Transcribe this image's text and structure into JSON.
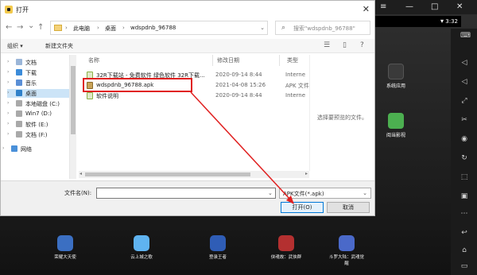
{
  "dialog": {
    "title": "打开",
    "close_glyph": "✕",
    "nav": {
      "back": "←",
      "forward": "→",
      "dropdown": "⌄",
      "up": "↑"
    },
    "breadcrumb": [
      "此电脑",
      "桌面",
      "wdspdnb_96788"
    ],
    "breadcrumb_sep": "›",
    "search_placeholder": "搜索\"wdspdnb_96788\"",
    "toolbar": {
      "organize": "组织 ▾",
      "new_folder": "新建文件夹"
    },
    "nav_pane": [
      {
        "label": "文档",
        "icon": "documents-icon"
      },
      {
        "label": "下载",
        "icon": "download-icon"
      },
      {
        "label": "音乐",
        "icon": "music-icon"
      },
      {
        "label": "桌面",
        "icon": "desktop-icon",
        "selected": true
      },
      {
        "label": "本地磁盘 (C:)",
        "icon": "drive-icon"
      },
      {
        "label": "Win7 (D:)",
        "icon": "drive-icon"
      },
      {
        "label": "软件 (E:)",
        "icon": "drive-icon"
      },
      {
        "label": "文档 (F:)",
        "icon": "drive-icon"
      },
      {
        "label": "网络",
        "icon": "network-icon"
      }
    ],
    "columns": {
      "name": "名称",
      "modified": "修改日期",
      "type": "类型"
    },
    "files": [
      {
        "name": "32R下载站 - 免费软件 绿色软件 32R下载...",
        "modified": "2020-09-14 8:44",
        "type": "Interne",
        "icon": "link-file-icon"
      },
      {
        "name": "wdspdnb_96788.apk",
        "modified": "2021-04-08 15:26",
        "type": "APK 文件",
        "icon": "apk-file-icon"
      },
      {
        "name": "软件说明",
        "modified": "2020-09-14 8:44",
        "type": "Interne",
        "icon": "link-file-icon"
      }
    ],
    "preview_hint": "选择要预览的文件。",
    "filename_label": "文件名(N):",
    "filename_value": "",
    "filter_value": "APK文件(*.apk)",
    "open_button": "打开(O)",
    "cancel_button": "取消"
  },
  "emulator": {
    "time": "3:32",
    "desktop_apps": [
      {
        "label": "系统应用",
        "color": "#3a3a3a"
      },
      {
        "label": "阅当影视",
        "color": "#4caf50"
      }
    ],
    "dock_apps": [
      {
        "label": "荣耀大天使",
        "color": "#3b6fc2"
      },
      {
        "label": "云上城之歌",
        "color": "#5fb3f0"
      },
      {
        "label": "登录王者",
        "color": "#2f5db6"
      },
      {
        "label": "侠魂故：武侠群",
        "color": "#b43030"
      },
      {
        "label": "斗罗大陆：武魂觉醒",
        "color": "#4a69c9"
      }
    ]
  },
  "colors": {
    "highlight": "#e02020",
    "selection": "#cce4f7",
    "primary_border": "#0078d7"
  }
}
